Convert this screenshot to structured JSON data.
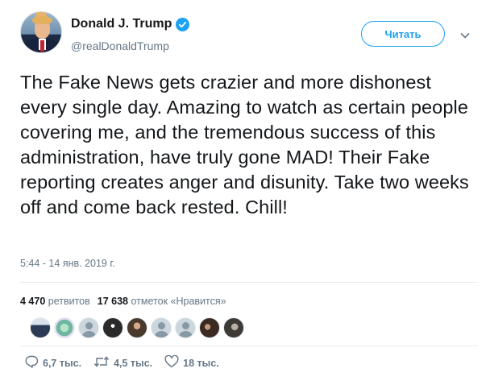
{
  "user": {
    "name": "Donald J. Trump",
    "handle": "@realDonaldTrump"
  },
  "follow_button": {
    "label": "Читать"
  },
  "tweet": {
    "text": "The Fake News gets crazier and more dishonest every single day. Amazing to watch as certain people covering me, and the tremendous success of this administration, have truly gone MAD! Their Fake reporting creates anger and disunity. Take two weeks off and come back rested. Chill!",
    "timestamp": "5:44 - 14 янв. 2019 г."
  },
  "stats": {
    "retweets_count": "4 470",
    "retweets_label": "ретвитов",
    "likes_count": "17 638",
    "likes_label": "отметок «Нравится»"
  },
  "likers": [
    {
      "icon": "user-avatar"
    },
    {
      "icon": "user-avatar"
    },
    {
      "icon": "default-avatar"
    },
    {
      "icon": "user-avatar"
    },
    {
      "icon": "user-avatar"
    },
    {
      "icon": "default-avatar"
    },
    {
      "icon": "default-avatar"
    },
    {
      "icon": "user-avatar"
    },
    {
      "icon": "user-avatar"
    }
  ],
  "actions": {
    "reply_count": "6,7 тыс.",
    "retweet_count": "4,5 тыс.",
    "like_count": "18 тыс."
  },
  "colors": {
    "accent": "#1da1f2",
    "text": "#14171a",
    "secondary": "#657786"
  }
}
